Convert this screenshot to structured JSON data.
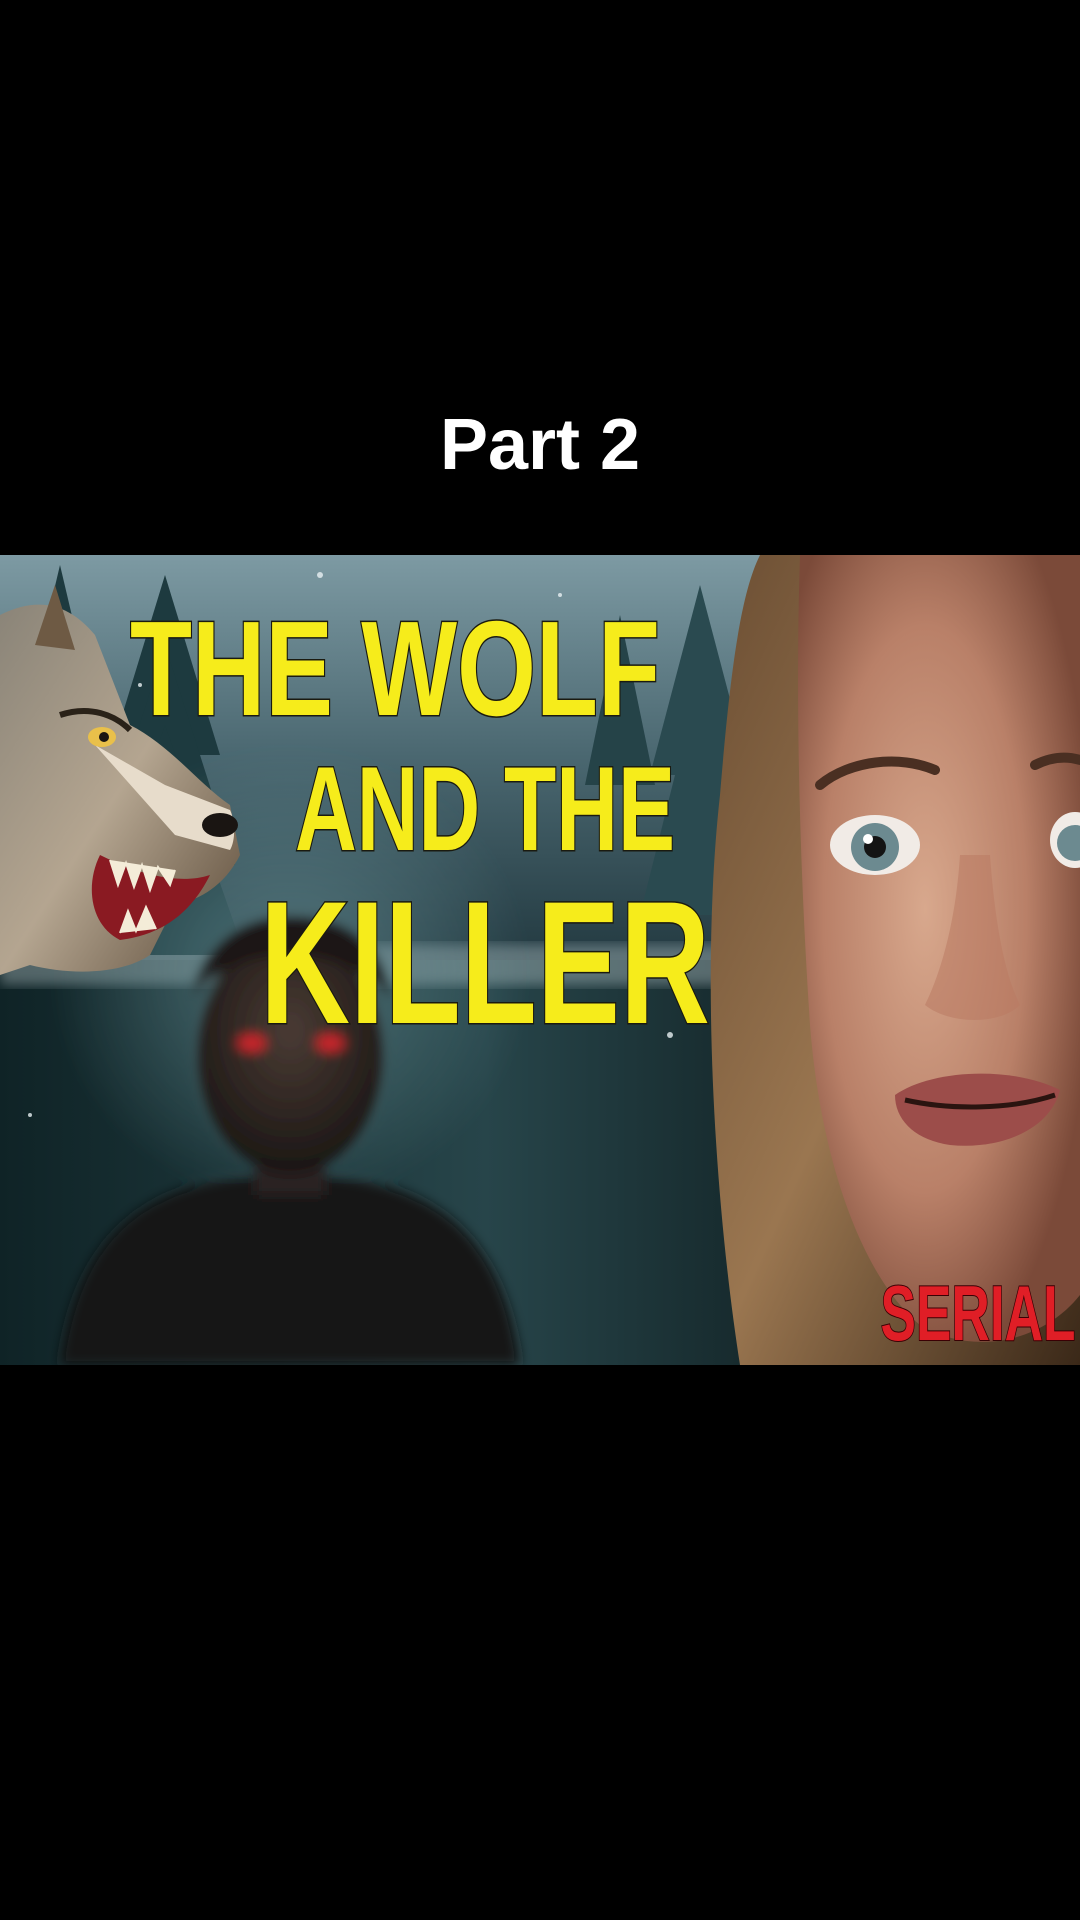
{
  "video": {
    "caption": "Part 2",
    "thumbnail": {
      "title_lines": [
        "THE WOLF",
        "AND THE",
        "KILLER"
      ],
      "tag": "SERIAL",
      "title_color": "#f6ec1b",
      "tag_color": "#e01e26"
    }
  },
  "icons": {
    "wolf": "snarling-wolf-illustration",
    "man": "blurred-man-red-eyes",
    "woman": "frightened-woman-face",
    "trees": "snowy-pine-forest"
  }
}
